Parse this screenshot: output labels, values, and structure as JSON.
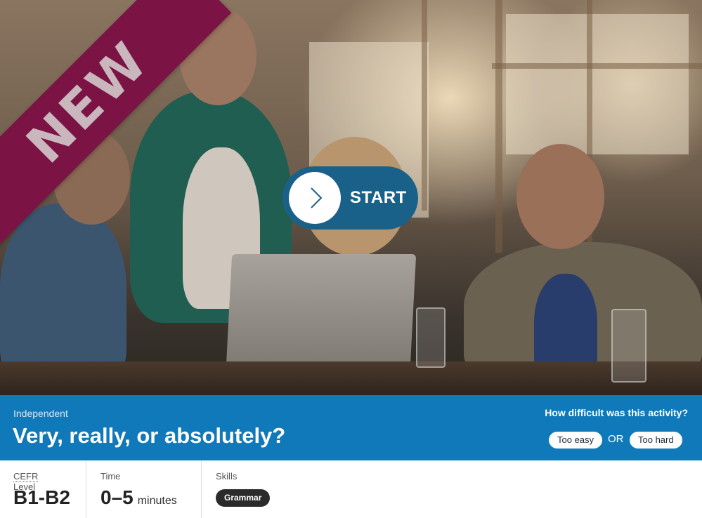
{
  "hero": {
    "ribbon_text": "NEW",
    "start_label": "START",
    "start_icon": "chevron-right-icon"
  },
  "activity": {
    "level": "Independent",
    "title": "Very, really, or absolutely?"
  },
  "feedback": {
    "question": "How difficult was this activity?",
    "too_easy": "Too easy",
    "or": "OR",
    "too_hard": "Too hard"
  },
  "details": {
    "cefr_abbr": "CEFR",
    "cefr_caption": " Level",
    "cefr_value": "B1-B2",
    "time_caption": "Time",
    "time_value": "0–5",
    "time_unit": "minutes",
    "skills_caption": "Skills",
    "skills": [
      "Grammar"
    ]
  },
  "colors": {
    "band": "#0f79ba",
    "ribbon": "#7b1345",
    "start_button": "#1a6189",
    "skill_pill": "#2b2b2b"
  }
}
